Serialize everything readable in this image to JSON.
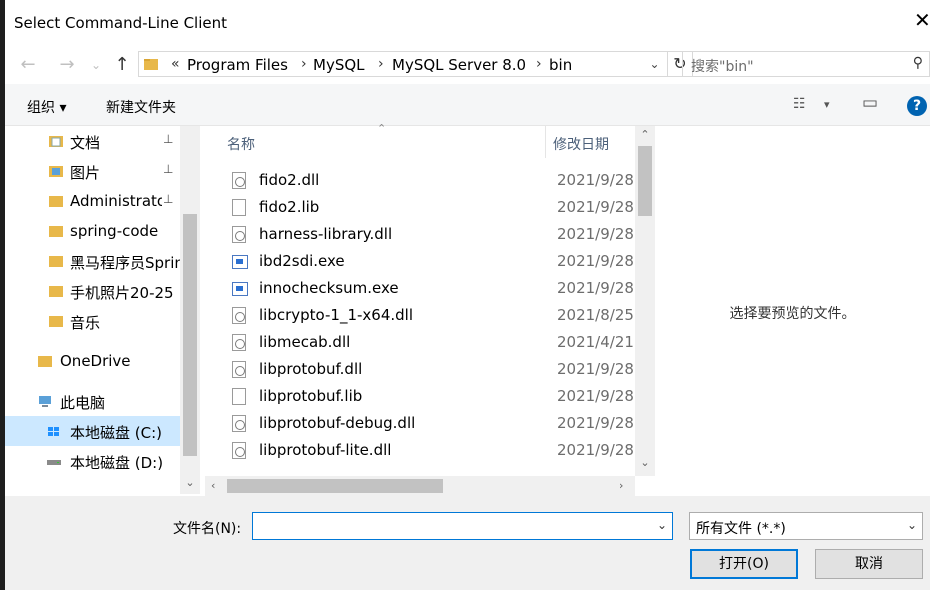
{
  "window": {
    "title": "Select Command-Line Client",
    "close_glyph": "✕"
  },
  "nav": {
    "back_glyph": "←",
    "forward_glyph": "→",
    "recent_glyph": "⌄",
    "up_glyph": "↑",
    "breadcrumb_overflow": "«",
    "path": [
      "Program Files",
      "MySQL",
      "MySQL Server 8.0",
      "bin"
    ],
    "path_sep": "›",
    "search_placeholder": "搜索\"bin\""
  },
  "toolbar": {
    "organize": "组织 ▾",
    "new_folder": "新建文件夹",
    "view_glyph": "☷",
    "view_dd": "▾",
    "pane_glyph": "▭",
    "help": "?"
  },
  "sidebar": {
    "items": [
      {
        "label": "文档",
        "icon": "documents-icon",
        "pinned": true
      },
      {
        "label": "图片",
        "icon": "pictures-icon",
        "pinned": true
      },
      {
        "label": "Administrato",
        "icon": "folder-icon",
        "pinned": true
      },
      {
        "label": "spring-code",
        "icon": "folder-icon",
        "pinned": false
      },
      {
        "label": "黑马程序员Sprin",
        "icon": "folder-icon",
        "pinned": false
      },
      {
        "label": "手机照片20-25",
        "icon": "folder-icon",
        "pinned": false
      },
      {
        "label": "音乐",
        "icon": "music-icon",
        "pinned": false
      },
      {
        "label": "OneDrive",
        "icon": "onedrive-icon",
        "pinned": false
      },
      {
        "label": "此电脑",
        "icon": "pc-icon",
        "pinned": false
      },
      {
        "label": "本地磁盘 (C:)",
        "icon": "drive-c-icon",
        "pinned": false,
        "selected": true
      },
      {
        "label": "本地磁盘 (D:)",
        "icon": "drive-d-icon",
        "pinned": false
      }
    ],
    "pin_glyph": "📌",
    "scroll_down": "⌄"
  },
  "files": {
    "columns": {
      "name": "名称",
      "modified": "修改日期"
    },
    "rows": [
      {
        "name": "fido2.dll",
        "date": "2021/9/28",
        "kind": "dll"
      },
      {
        "name": "fido2.lib",
        "date": "2021/9/28",
        "kind": "lib"
      },
      {
        "name": "harness-library.dll",
        "date": "2021/9/28",
        "kind": "dll"
      },
      {
        "name": "ibd2sdi.exe",
        "date": "2021/9/28",
        "kind": "exe"
      },
      {
        "name": "innochecksum.exe",
        "date": "2021/9/28",
        "kind": "exe"
      },
      {
        "name": "libcrypto-1_1-x64.dll",
        "date": "2021/8/25",
        "kind": "dll"
      },
      {
        "name": "libmecab.dll",
        "date": "2021/4/21",
        "kind": "dll"
      },
      {
        "name": "libprotobuf.dll",
        "date": "2021/9/28",
        "kind": "dll"
      },
      {
        "name": "libprotobuf.lib",
        "date": "2021/9/28",
        "kind": "lib"
      },
      {
        "name": "libprotobuf-debug.dll",
        "date": "2021/9/28",
        "kind": "dll"
      },
      {
        "name": "libprotobuf-lite.dll",
        "date": "2021/9/28",
        "kind": "dll"
      }
    ]
  },
  "preview": {
    "message": "选择要预览的文件。"
  },
  "bottom": {
    "filename_label": "文件名(N):",
    "filename_value": "",
    "filetype": "所有文件 (*.*)",
    "open": "打开(O)",
    "cancel": "取消"
  }
}
